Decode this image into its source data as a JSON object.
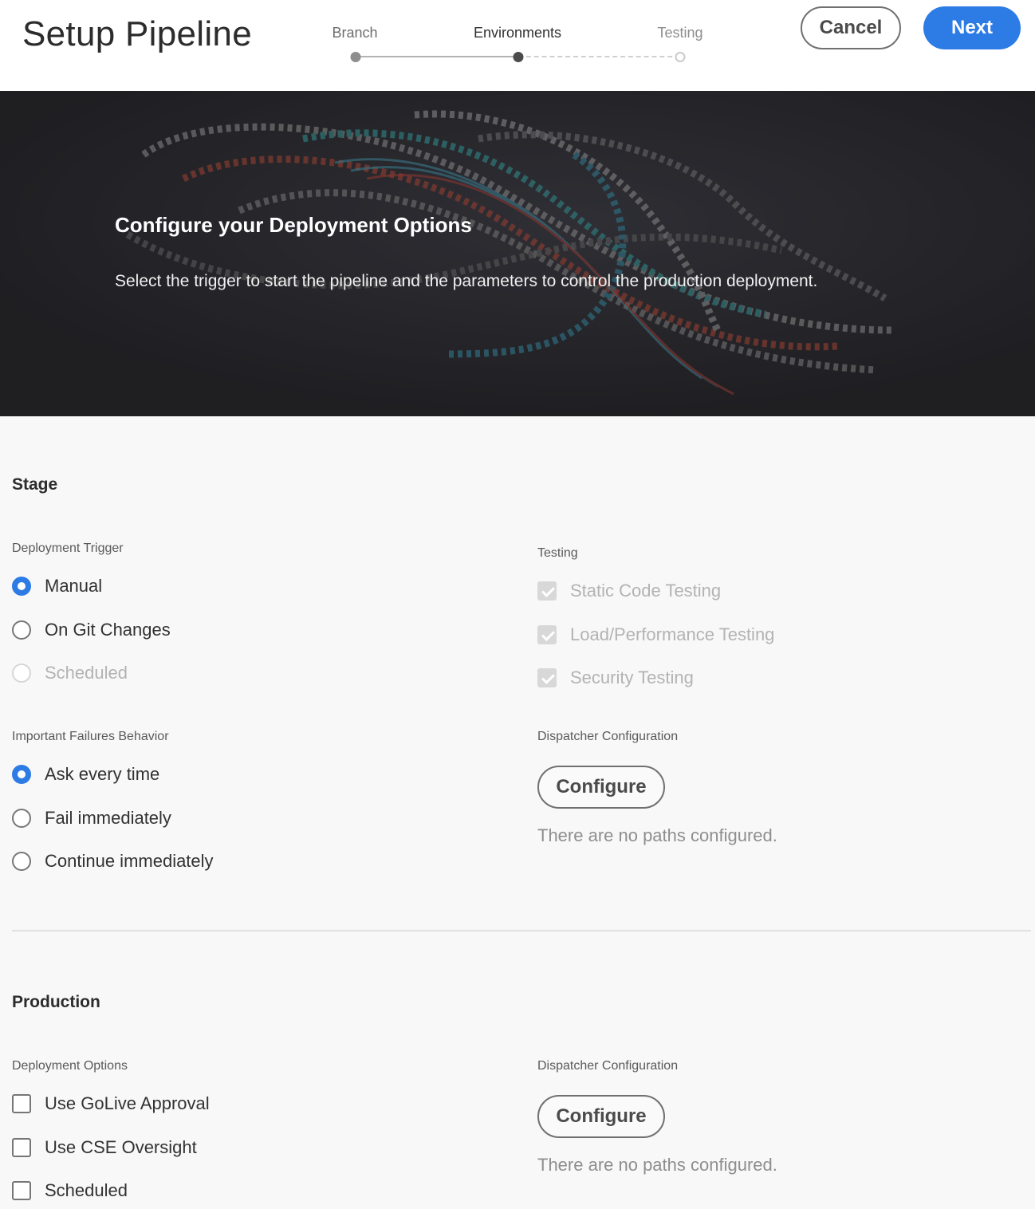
{
  "header": {
    "title": "Setup Pipeline",
    "steps": [
      {
        "label": "Branch"
      },
      {
        "label": "Environments"
      },
      {
        "label": "Testing"
      }
    ],
    "cancel_label": "Cancel",
    "next_label": "Next"
  },
  "hero": {
    "title": "Configure your Deployment Options",
    "subtitle": "Select the trigger to start the pipeline and the parameters to control the production deployment."
  },
  "stage": {
    "title": "Stage",
    "deployment_trigger": {
      "label": "Deployment Trigger",
      "options": [
        "Manual",
        "On Git Changes",
        "Scheduled"
      ],
      "selected": "Manual"
    },
    "failures_behavior": {
      "label": "Important Failures Behavior",
      "options": [
        "Ask every time",
        "Fail immediately",
        "Continue immediately"
      ],
      "selected": "Ask every time"
    },
    "testing": {
      "label": "Testing",
      "options": [
        "Static Code Testing",
        "Load/Performance Testing",
        "Security Testing"
      ]
    },
    "dispatcher": {
      "label": "Dispatcher Configuration",
      "button_label": "Configure",
      "empty_text": "There are no paths configured."
    }
  },
  "production": {
    "title": "Production",
    "deployment_options": {
      "label": "Deployment Options",
      "options": [
        "Use GoLive Approval",
        "Use CSE Oversight",
        "Scheduled"
      ]
    },
    "dispatcher": {
      "label": "Dispatcher Configuration",
      "button_label": "Configure",
      "empty_text": "There are no paths configured."
    }
  },
  "colors": {
    "accent": "#2d7be5",
    "hero_bg": "#2b2b30"
  }
}
